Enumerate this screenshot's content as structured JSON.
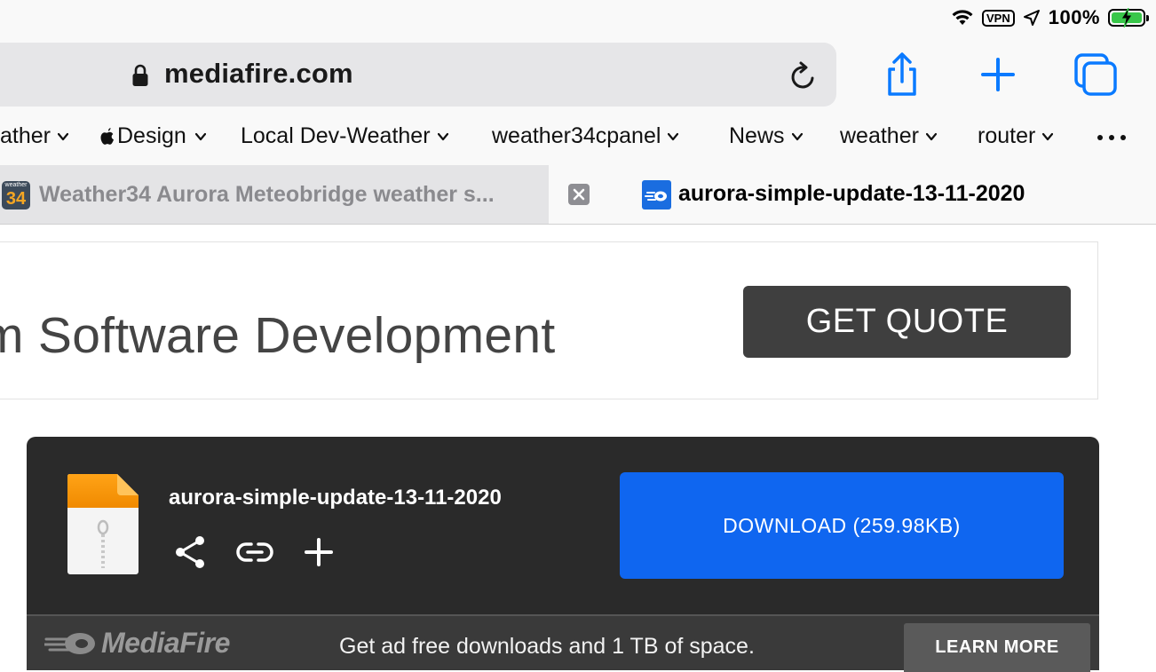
{
  "status_bar": {
    "vpn_label": "VPN",
    "battery_percent": "100%",
    "battery_level": 1.0
  },
  "toolbar": {
    "url": "mediafire.com"
  },
  "bookmarks": [
    {
      "label": "ather"
    },
    {
      "label": "Design"
    },
    {
      "label": "Local Dev-Weather"
    },
    {
      "label": "weather34cpanel"
    },
    {
      "label": "News"
    },
    {
      "label": "weather"
    },
    {
      "label": "router"
    }
  ],
  "tabs": {
    "inactive": {
      "title": "Weather34 Aurora Meteobridge weather s...",
      "favicon_top": "weather",
      "favicon_number": "34"
    },
    "active": {
      "title": "aurora-simple-update-13-11-2020"
    }
  },
  "ad": {
    "headline": "m Software Development",
    "cta": "GET QUOTE"
  },
  "download_card": {
    "file_name": "aurora-simple-update-13-11-2020",
    "download_label": "DOWNLOAD (259.98KB)"
  },
  "promo": {
    "logo_text": "MediaFire",
    "text": "Get ad free downloads and 1 TB of space.",
    "cta": "LEARN MORE"
  },
  "colors": {
    "accent_blue": "#0f66f0",
    "ios_blue": "#0a7aff",
    "battery_green": "#39c74a",
    "card_bg": "#2a2a2a"
  }
}
